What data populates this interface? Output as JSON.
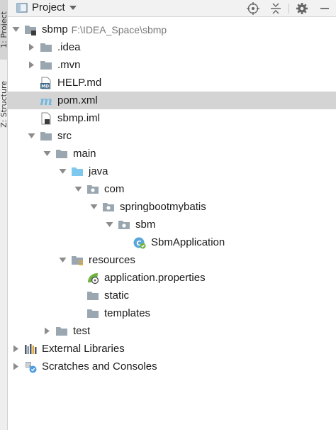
{
  "sidebar": {
    "project_tab": "1: Project",
    "structure_tab": "Z: Structure"
  },
  "header": {
    "title": "Project"
  },
  "tree": [
    {
      "name": "sbmp",
      "path": "F:\\IDEA_Space\\sbmp",
      "depth": 0,
      "arrow": "down",
      "icon": "module-folder-icon"
    },
    {
      "name": ".idea",
      "depth": 1,
      "arrow": "right",
      "icon": "folder-icon"
    },
    {
      "name": ".mvn",
      "depth": 1,
      "arrow": "right",
      "icon": "folder-icon"
    },
    {
      "name": "HELP.md",
      "depth": 1,
      "arrow": "none",
      "icon": "markdown-file-icon"
    },
    {
      "name": "pom.xml",
      "depth": 1,
      "arrow": "none",
      "icon": "maven-file-icon",
      "selected": true
    },
    {
      "name": "sbmp.iml",
      "depth": 1,
      "arrow": "none",
      "icon": "iml-file-icon"
    },
    {
      "name": "src",
      "depth": 1,
      "arrow": "down",
      "icon": "folder-icon"
    },
    {
      "name": "main",
      "depth": 2,
      "arrow": "down",
      "icon": "folder-icon"
    },
    {
      "name": "java",
      "depth": 3,
      "arrow": "down",
      "icon": "source-folder-icon"
    },
    {
      "name": "com",
      "depth": 4,
      "arrow": "down",
      "icon": "package-icon"
    },
    {
      "name": "springbootmybatis",
      "depth": 5,
      "arrow": "down",
      "icon": "package-icon"
    },
    {
      "name": "sbm",
      "depth": 6,
      "arrow": "down",
      "icon": "package-icon"
    },
    {
      "name": "SbmApplication",
      "depth": 7,
      "arrow": "none",
      "icon": "spring-class-icon"
    },
    {
      "name": "resources",
      "depth": 3,
      "arrow": "down",
      "icon": "resources-folder-icon"
    },
    {
      "name": "application.properties",
      "depth": 4,
      "arrow": "none",
      "icon": "spring-properties-icon"
    },
    {
      "name": "static",
      "depth": 4,
      "arrow": "none",
      "icon": "folder-icon"
    },
    {
      "name": "templates",
      "depth": 4,
      "arrow": "none",
      "icon": "folder-icon"
    },
    {
      "name": "test",
      "depth": 2,
      "arrow": "right",
      "icon": "folder-icon"
    },
    {
      "name": "External Libraries",
      "depth": 0,
      "arrow": "right",
      "icon": "libraries-icon"
    },
    {
      "name": "Scratches and Consoles",
      "depth": 0,
      "arrow": "right",
      "icon": "scratches-icon"
    }
  ],
  "colors": {
    "folder": "#9aa7b0",
    "source_folder": "#7ec7ee",
    "maven": "#70b7e0",
    "spring": "#6db33f",
    "selection": "#d4d4d4",
    "arrow": "#8c8c8c"
  }
}
